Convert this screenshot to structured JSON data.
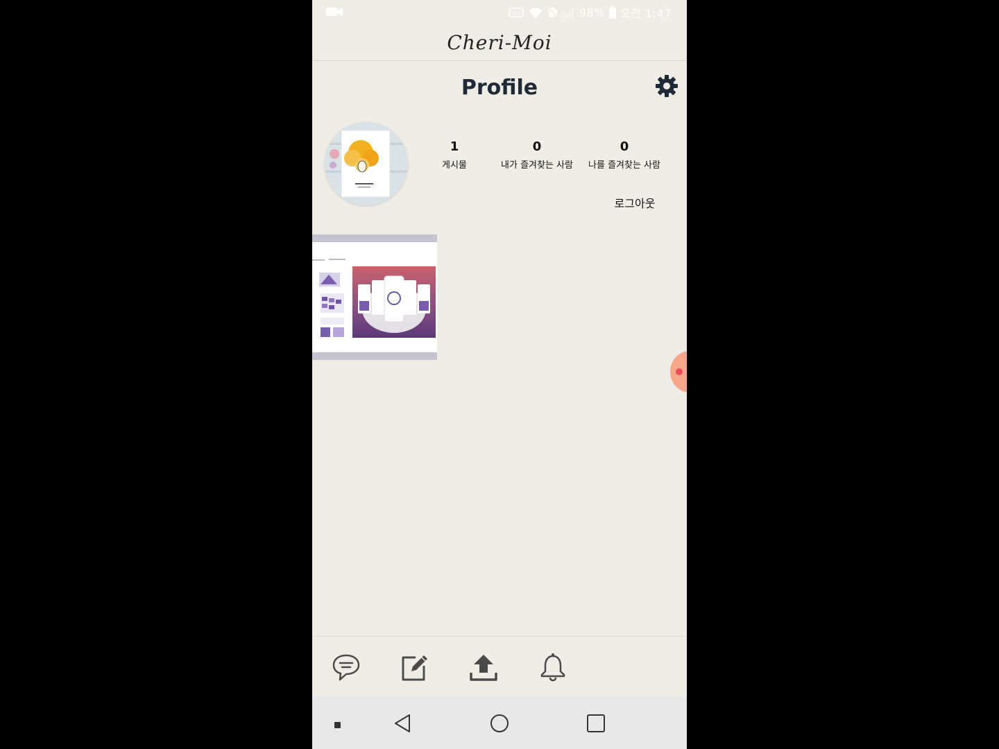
{
  "status_bar": {
    "battery": "98%",
    "time": "오전 1:47"
  },
  "header": {
    "brand": "Cheri-Moi"
  },
  "page": {
    "title": "Profile"
  },
  "profile": {
    "stats": [
      {
        "value": "1",
        "label": "게시물"
      },
      {
        "value": "0",
        "label": "내가 즐겨찾는 사람"
      },
      {
        "value": "0",
        "label": "나를 즐겨찾는 사람"
      }
    ],
    "logout_label": "로그아웃"
  },
  "colors": {
    "background": "#efede5",
    "title": "#1f2a38",
    "icon": "#4a4a4a",
    "accent_float": "#f6a78a"
  },
  "icons": {
    "settings": "gear-icon",
    "tabs": [
      "chat-icon",
      "edit-icon",
      "upload-icon",
      "bell-icon"
    ],
    "nav": [
      "dot-icon",
      "back-icon",
      "home-icon",
      "recents-icon"
    ]
  }
}
